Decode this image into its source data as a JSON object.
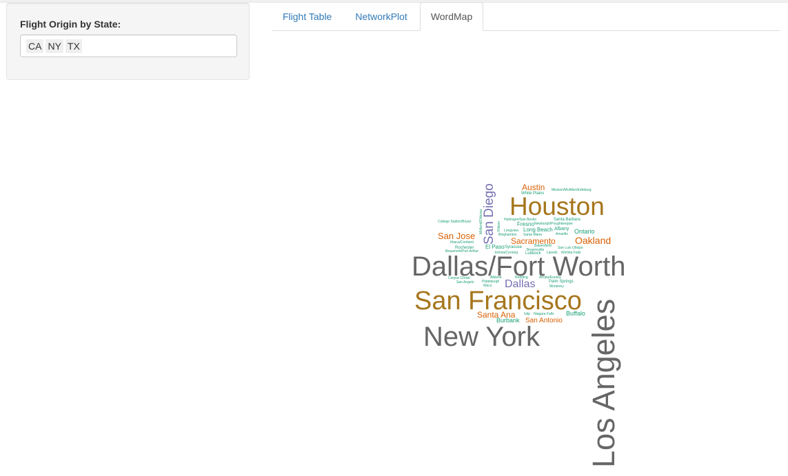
{
  "sidebar": {
    "label": "Flight Origin by State:",
    "selected": [
      "CA",
      "NY",
      "TX"
    ]
  },
  "tabs": [
    {
      "label": "Flight Table",
      "active": false
    },
    {
      "label": "NetworkPlot",
      "active": false
    },
    {
      "label": "WordMap",
      "active": true
    }
  ],
  "wordcloud": {
    "colors": {
      "gray": "#666666",
      "gold": "#a6761d",
      "orange": "#d95f02",
      "purple": "#7570b3",
      "teal": "#1b9e77"
    },
    "words": [
      "Los Angeles",
      "Dallas/Fort Worth",
      "San Francisco",
      "New York",
      "Houston",
      "San Diego",
      "Dallas",
      "Oakland",
      "Sacramento",
      "San Jose",
      "Austin",
      "Santa Ana",
      "San Antonio",
      "Burbank",
      "Buffalo",
      "Ontario",
      "Long Beach",
      "El Paso",
      "Fresno",
      "Albany",
      "White Plains",
      "Mission/McAllen/Edinburg",
      "Harlingen/San Benito",
      "Santa Barbara",
      "Newburgh/Poughkeepsie",
      "College Station/Bryan",
      "Midland/Odessa",
      "Killeen",
      "Longview",
      "Binghamton",
      "Santa Maria",
      "Amarillo",
      "Ithaca/Cortland",
      "Rochester",
      "Beaumont/Port Arthur",
      "Syracuse",
      "Bakersfield",
      "Brownsville",
      "San Luis Obispo",
      "Elmira/Corning",
      "Lubbock",
      "Laredo",
      "Wichita Falls",
      "Corpus Christi",
      "Abilene",
      "Redding",
      "Arcata/Eureka",
      "San Angelo",
      "Plattsburgh",
      "Palm Springs",
      "Waco",
      "Monterey",
      "Islip",
      "Niagara Falls"
    ]
  }
}
